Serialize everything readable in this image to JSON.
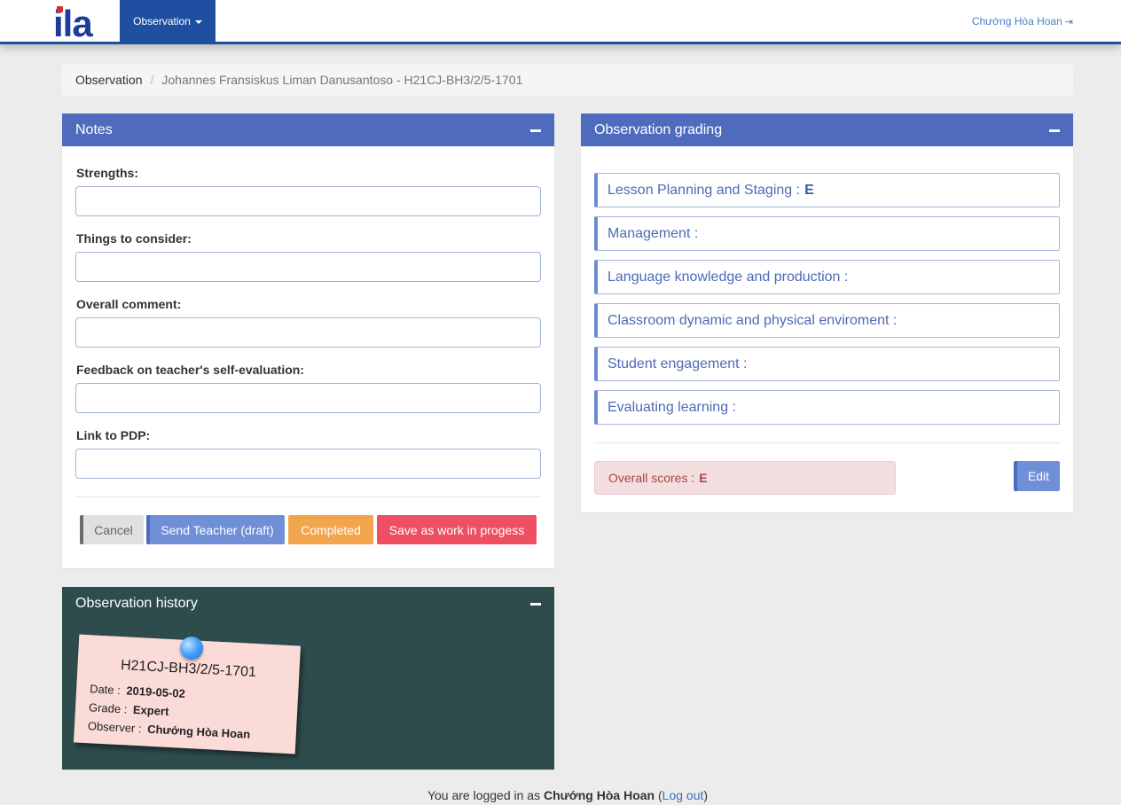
{
  "nav": {
    "logo": "ila",
    "menu_label": "Observation",
    "user_name": "Chướng Hòa Hoan"
  },
  "breadcrumb": {
    "first": "Observation",
    "separator": "/",
    "current": "Johannes Fransiskus Liman Danusantoso - H21CJ-BH3/2/5-1701"
  },
  "notes": {
    "title": "Notes",
    "fields": [
      {
        "label": "Strengths:",
        "value": ""
      },
      {
        "label": "Things to consider:",
        "value": ""
      },
      {
        "label": "Overall comment:",
        "value": ""
      },
      {
        "label": "Feedback on teacher's self-evaluation:",
        "value": ""
      },
      {
        "label": "Link to PDP:",
        "value": ""
      }
    ],
    "buttons": {
      "cancel": "Cancel",
      "send": "Send Teacher (draft)",
      "completed": "Completed",
      "save": "Save as work in progess"
    }
  },
  "grading": {
    "title": "Observation grading",
    "items": [
      {
        "label": "Lesson Planning and Staging :",
        "grade": "E"
      },
      {
        "label": "Management :",
        "grade": ""
      },
      {
        "label": "Language knowledge and production :",
        "grade": ""
      },
      {
        "label": "Classroom dynamic and physical enviroment :",
        "grade": ""
      },
      {
        "label": "Student engagement :",
        "grade": ""
      },
      {
        "label": "Evaluating learning :",
        "grade": ""
      }
    ],
    "overall_label": "Overall scores :",
    "overall_value": "E",
    "edit_label": "Edit"
  },
  "history": {
    "title": "Observation history",
    "card": {
      "code": "H21CJ-BH3/2/5-1701",
      "date_label": "Date :",
      "date_value": "2019-05-02",
      "grade_label": "Grade :",
      "grade_value": "Expert",
      "observer_label": "Observer :",
      "observer_value": "Chướng Hòa Hoan"
    }
  },
  "footer": {
    "prefix": "You are logged in as",
    "user": "Chướng Hòa Hoan",
    "open_paren": "(",
    "logout": "Log out",
    "close_paren": ")"
  },
  "colors": {
    "panel_header": "#4f6bbd",
    "navbar_accent": "#1f4fa1",
    "history_bg": "#2f4c4d",
    "completed": "#f3a54e",
    "save": "#ef4f62"
  }
}
